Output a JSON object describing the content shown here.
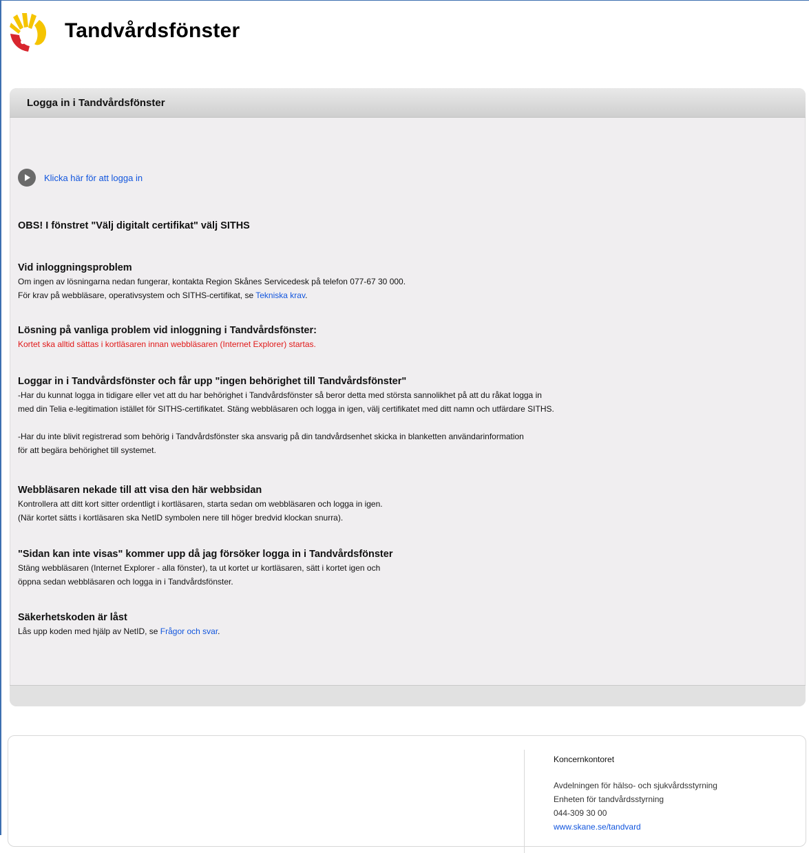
{
  "header": {
    "app_title": "Tandvårdsfönster",
    "logo_icon": "skane-logo-icon"
  },
  "panel": {
    "title": "Logga in i Tandvårdsfönster",
    "login_link": "Klicka här för att logga in",
    "obs_note": "OBS! I fönstret \"Välj digitalt certifikat\" välj SITHS",
    "sections": [
      {
        "heading": "Vid inloggningsproblem",
        "line1": "Om ingen av lösningarna nedan fungerar, kontakta Region Skånes Servicedesk på telefon 077-67 30 000.",
        "line2_prefix": "För krav på webbläsare, operativsystem och SITHS-certifikat, se ",
        "line2_link": "Tekniska krav",
        "line2_suffix": "."
      },
      {
        "heading": "Lösning på vanliga problem vid inloggning i Tandvårdsfönster:",
        "warning": "Kortet ska alltid sättas i kortläsaren innan webbläsaren (Internet Explorer) startas."
      },
      {
        "heading": "Loggar in i Tandvårdsfönster och får upp \"ingen behörighet till Tandvårdsfönster\"",
        "p1_line1": "-Har du kunnat logga in tidigare eller vet att du har behörighet i Tandvårdsfönster så beror detta med största sannolikhet på att du råkat logga in",
        "p1_line2": "med din Telia e-legitimation istället för SITHS-certifikatet. Stäng webbläsaren och logga in igen, välj certifikatet med ditt namn och utfärdare SITHS.",
        "p2_line1": "-Har du inte blivit registrerad som behörig i Tandvårdsfönster ska ansvarig på din tandvårdsenhet skicka in blanketten användarinformation",
        "p2_line2": "för att begära behörighet till systemet."
      },
      {
        "heading": "Webbläsaren nekade till att visa den här webbsidan",
        "line1": "Kontrollera att ditt kort sitter ordentligt i kortläsaren, starta sedan om webbläsaren och logga in igen.",
        "line2": "(När kortet sätts i kortläsaren ska NetID symbolen nere till höger bredvid klockan snurra)."
      },
      {
        "heading": "\"Sidan kan inte visas\" kommer upp då jag försöker logga in i Tandvårdsfönster",
        "line1": "Stäng webbläsaren (Internet Explorer - alla fönster), ta ut kortet ur kortläsaren, sätt i kortet igen och",
        "line2": "öppna sedan webbläsaren och logga in i Tandvårdsfönster."
      },
      {
        "heading": "Säkerhetskoden är låst",
        "line_prefix": "Lås upp koden med hjälp av NetID, se ",
        "line_link": "Frågor och svar",
        "line_suffix": "."
      }
    ]
  },
  "footer": {
    "org": "Koncernkontoret",
    "dept": "Avdelningen för hälso- och sjukvårdsstyrning",
    "unit": "Enheten för tandvårdsstyrning",
    "phone": "044-309 30 00",
    "website": "www.skane.se/tandvard"
  },
  "colors": {
    "link": "#1155dd",
    "warning": "#e01818",
    "logo_yellow": "#f5c400",
    "logo_red": "#d8262e"
  }
}
